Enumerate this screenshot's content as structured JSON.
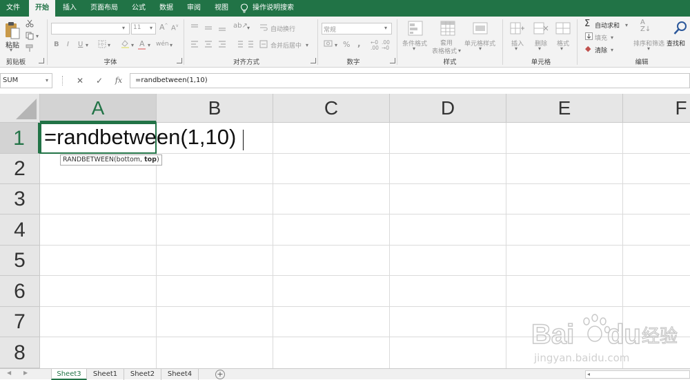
{
  "menu": {
    "tabs": [
      "文件",
      "开始",
      "插入",
      "页面布局",
      "公式",
      "数据",
      "审阅",
      "视图"
    ],
    "active": "开始",
    "tell_me": "操作说明搜索"
  },
  "ribbon": {
    "clipboard": {
      "title": "剪贴板",
      "paste": "粘贴"
    },
    "font": {
      "title": "字体",
      "size": "11",
      "bold": "B",
      "italic": "I",
      "underline": "U"
    },
    "alignment": {
      "title": "对齐方式",
      "wrap": "自动换行",
      "merge": "合并后居中"
    },
    "number": {
      "title": "数字",
      "format": "常规",
      "percent": "%",
      "comma": ","
    },
    "styles": {
      "title": "样式",
      "conditional": "条件格式",
      "table_1": "套用",
      "table_2": "表格格式",
      "cell_styles": "单元格样式"
    },
    "cells": {
      "title": "单元格",
      "insert": "插入",
      "delete": "删除",
      "format": "格式"
    },
    "editing": {
      "title": "编辑",
      "autosum": "自动求和",
      "fill": "填充",
      "clear": "清除",
      "sort": "排序和筛选",
      "find": "查找和"
    }
  },
  "formula_bar": {
    "name_box": "SUM",
    "cancel": "✕",
    "enter": "✓",
    "fx": "fx",
    "formula": "=randbetween(1,10)"
  },
  "grid": {
    "columns": [
      "A",
      "B",
      "C",
      "D",
      "E",
      "F"
    ],
    "rows": [
      "1",
      "2",
      "3",
      "4",
      "5",
      "6",
      "7",
      "8"
    ],
    "active_cell": "A1",
    "cell_text": "=randbetween(1,10)",
    "tooltip_fn": "RANDBETWEEN(bottom, ",
    "tooltip_arg": "top",
    "tooltip_end": ")"
  },
  "sheets": {
    "tabs": [
      "Sheet3",
      "Sheet1",
      "Sheet2",
      "Sheet4"
    ],
    "active": "Sheet3",
    "add": "+"
  },
  "watermark": {
    "text": "Bai",
    "text2": "经验",
    "url": "jingyan.baidu.com"
  },
  "colors": {
    "excel_green": "#217346",
    "ribbon_bg": "#f3f3f3",
    "header_bg": "#e6e6e6"
  }
}
